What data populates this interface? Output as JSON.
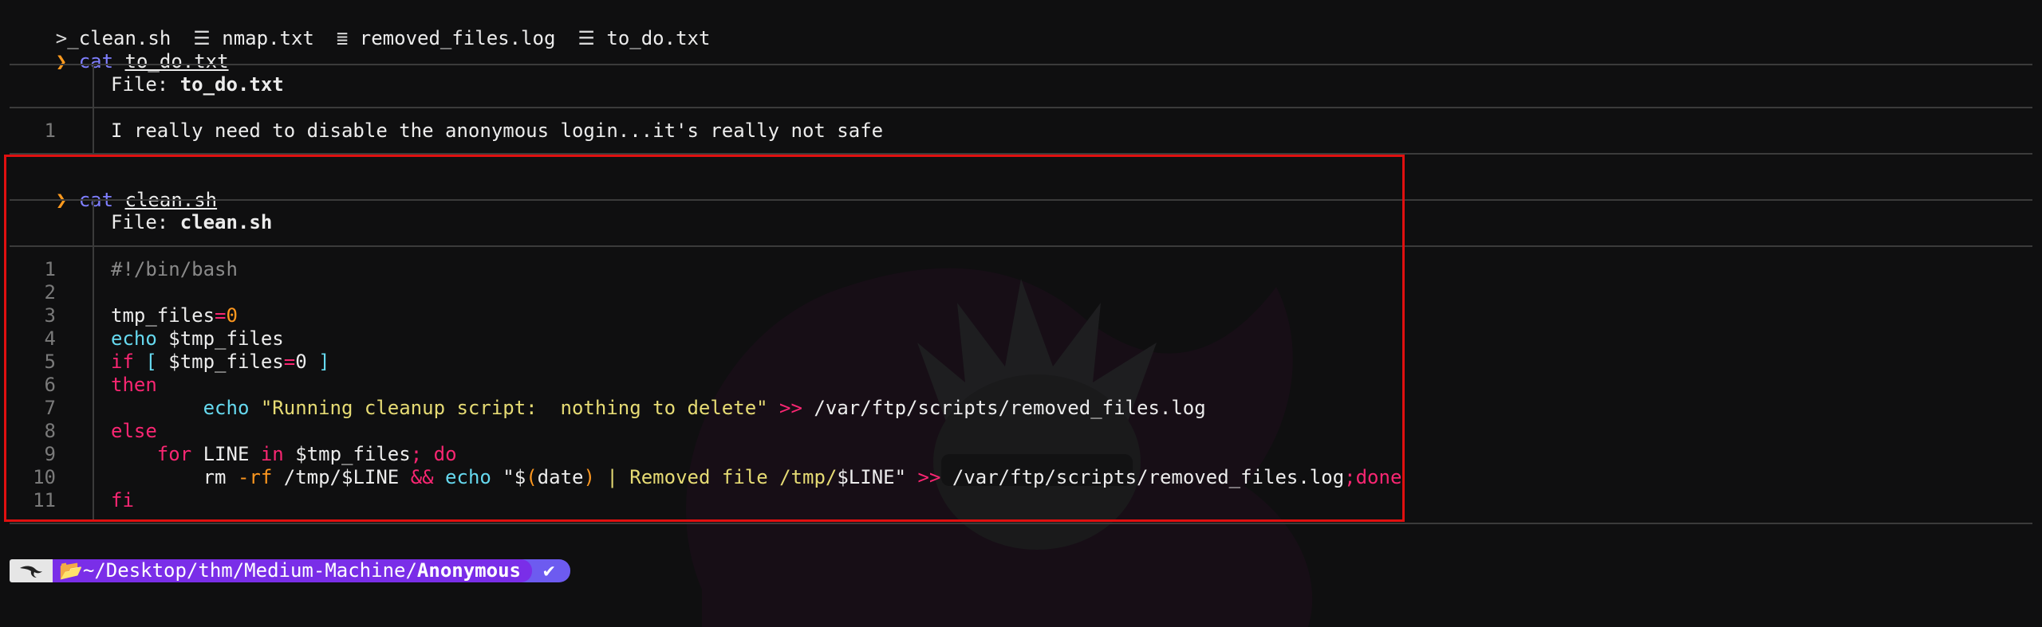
{
  "ls": {
    "items": [
      {
        "icon": "terminal-icon",
        "glyph": ">_",
        "name": "clean.sh"
      },
      {
        "icon": "file-text-icon",
        "glyph": "☰",
        "name": "nmap.txt"
      },
      {
        "icon": "log-file-icon",
        "glyph": "≣",
        "name": "removed_files.log"
      },
      {
        "icon": "file-text-icon",
        "glyph": "☰",
        "name": "to_do.txt"
      }
    ]
  },
  "prompt_symbol": "❯",
  "cmd1": {
    "command": "cat",
    "arg": "to_do.txt"
  },
  "file1": {
    "label": "File:",
    "name": "to_do.txt",
    "lines": [
      {
        "n": "1",
        "text": "I really need to disable the anonymous login...it's really not safe"
      }
    ]
  },
  "cmd2": {
    "command": "cat",
    "arg": "clean.sh"
  },
  "file2": {
    "label": "File:",
    "name": "clean.sh",
    "line_numbers": [
      "1",
      "2",
      "3",
      "4",
      "5",
      "6",
      "7",
      "8",
      "9",
      "10",
      "11"
    ],
    "code": {
      "l1": "#!/bin/bash",
      "l3_var": "tmp_files",
      "l3_eq": "=",
      "l3_val": "0",
      "l4_cmd": "echo",
      "l4_rest": " $tmp_files",
      "l5_if": "if",
      "l5_open": " [",
      "l5_var": " $tmp_files",
      "l5_eq": "=",
      "l5_val": "0",
      "l5_close": " ]",
      "l6": "then",
      "l7_indent": "        ",
      "l7_cmd": "echo",
      "l7_str": " \"Running cleanup script:  nothing to delete\"",
      "l7_op": " >>",
      "l7_path": " /var/ftp/scripts/removed_files.log",
      "l8": "else",
      "l9_indent": "    ",
      "l9_for": "for",
      "l9_var": " LINE",
      "l9_in": " in",
      "l9_rest": " $tmp_files",
      "l9_semi": ";",
      "l9_do": " do",
      "l10_indent": "        ",
      "l10_rm": "rm",
      "l10_flag": " -rf",
      "l10_path": " /tmp/$LINE",
      "l10_and": " &&",
      "l10_echo": " echo",
      "l10_q1": " \"$",
      "l10_p1": "(",
      "l10_date": "date",
      "l10_p2": ")",
      "l10_mid": " | Removed file /tmp/",
      "l10_var": "$LINE",
      "l10_q2": "\"",
      "l10_op": " >>",
      "l10_logpath": " /var/ftp/scripts/removed_files.log",
      "l10_semi": ";",
      "l10_done": "done",
      "l11": "fi"
    }
  },
  "statusbar": {
    "logo": "kali-dragon-icon",
    "folder_icon": "folder-open-icon",
    "path_prefix": "~/Desktop/thm/Medium-Machine/",
    "path_current": "Anonymous",
    "check": "✔"
  },
  "colors": {
    "keyword": "#f92672",
    "builtin": "#66d9ef",
    "string": "#e6db74",
    "number": "#ae81ff",
    "prompt_arrow": "#ff9a1e",
    "command": "#7f7fff",
    "highlight_border": "#e01010",
    "path_segment": "#7a2ee8",
    "status_segment": "#6d5bf0"
  }
}
